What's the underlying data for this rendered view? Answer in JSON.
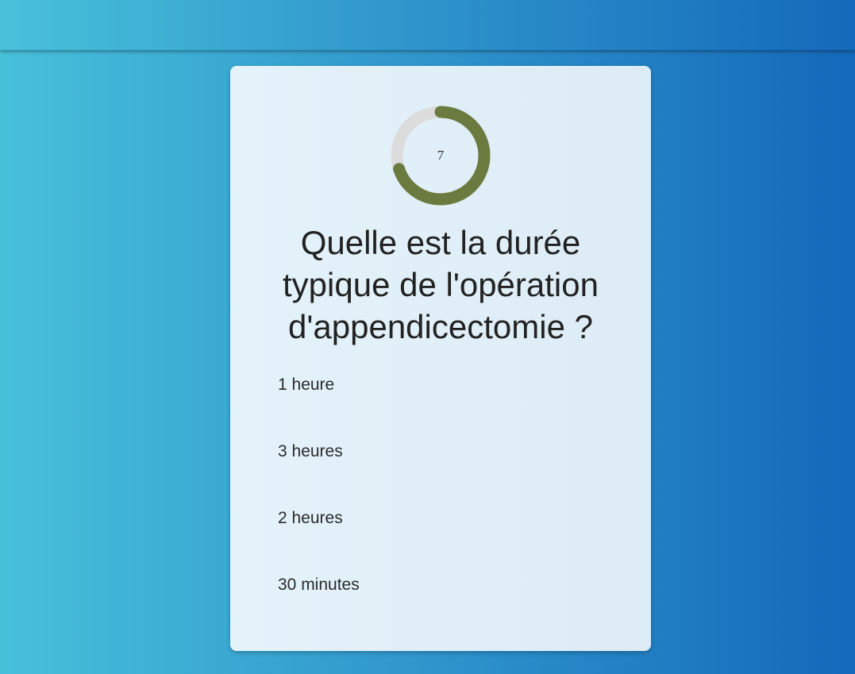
{
  "timer": {
    "value": "7",
    "progress": 0.7,
    "progress_color": "#6b7a3f",
    "track_color": "#dcdcdc"
  },
  "question": {
    "text": "Quelle est la durée typique de l'opération d'appendicectomie ?"
  },
  "answers": [
    {
      "label": "1 heure"
    },
    {
      "label": "3 heures"
    },
    {
      "label": "2 heures"
    },
    {
      "label": "30 minutes"
    }
  ]
}
